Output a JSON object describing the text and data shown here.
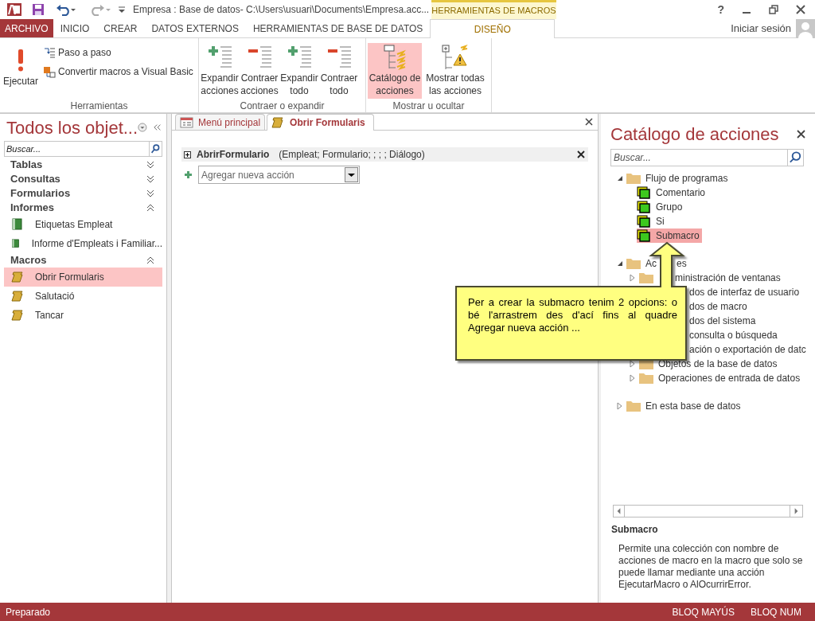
{
  "title_bar": {
    "title": "Empresa : Base de datos- C:\\Users\\usuari\\Documents\\Empresa.acc...",
    "contextual_tab": "HERRAMIENTAS DE MACROS",
    "help": "?"
  },
  "ribbon_tabs": [
    {
      "label": "ARCHIVO",
      "kind": "file",
      "selected": false
    },
    {
      "label": "INICIO",
      "kind": "tab",
      "selected": false
    },
    {
      "label": "CREAR",
      "kind": "tab",
      "selected": false
    },
    {
      "label": "DATOS EXTERNOS",
      "kind": "tab",
      "selected": false
    },
    {
      "label": "HERRAMIENTAS DE BASE DE DATOS",
      "kind": "tab",
      "selected": false
    },
    {
      "label": "DISEÑO",
      "kind": "contextual",
      "selected": true
    }
  ],
  "account": {
    "label": "Iniciar sesión"
  },
  "ribbon_groups": [
    {
      "label": "Herramientas",
      "buttons": [
        {
          "label": "Ejecutar",
          "kind": "run"
        },
        {
          "label": "Paso a paso",
          "kind": "step"
        },
        {
          "label": "Convertir macros a Visual Basic",
          "kind": "convert"
        }
      ]
    },
    {
      "label": "Contraer o expandir",
      "buttons": [
        {
          "label": "Expandir acciones",
          "kind": "expand"
        },
        {
          "label": "Contraer acciones",
          "kind": "collapse"
        },
        {
          "label": "Expandir todo",
          "kind": "expand"
        },
        {
          "label": "Contraer todo",
          "kind": "collapse"
        }
      ]
    },
    {
      "label": "Mostrar u ocultar",
      "buttons": [
        {
          "label": "Catálogo de acciones",
          "kind": "catalog",
          "selected": true
        },
        {
          "label": "Mostrar todas las acciones",
          "kind": "show-all",
          "selected": false
        }
      ]
    }
  ],
  "navigation": {
    "title": "Todos los objet...",
    "search": {
      "placeholder": "Buscar..."
    },
    "groups": [
      {
        "label": "Tablas",
        "expanded": false
      },
      {
        "label": "Consultas",
        "expanded": false
      },
      {
        "label": "Formularios",
        "expanded": false
      },
      {
        "label": "Informes",
        "expanded": true,
        "items": [
          {
            "label": "Etiquetas Empleat",
            "kind": "report",
            "selected": false
          },
          {
            "label": "Informe d'Empleats i Familiar...",
            "kind": "report",
            "selected": false
          }
        ]
      },
      {
        "label": "Macros",
        "expanded": true,
        "items": [
          {
            "label": "Obrir Formularis",
            "kind": "macro",
            "selected": true
          },
          {
            "label": "Salutació",
            "kind": "macro",
            "selected": false
          },
          {
            "label": "Tancar",
            "kind": "macro",
            "selected": false
          }
        ]
      }
    ]
  },
  "document": {
    "tabs": [
      {
        "label": "Menú principal",
        "kind": "form",
        "selected": false
      },
      {
        "label": "Obrir Formularis",
        "kind": "macro",
        "selected": true
      }
    ],
    "actions": [
      {
        "name": "AbrirFormulario",
        "arguments": "(Empleat; Formulario; ; ; ; Diálogo)",
        "expanded": false
      }
    ],
    "new_action": {
      "placeholder": "Agregar nueva acción"
    }
  },
  "catalog": {
    "title": "Catálogo de acciones",
    "search": {
      "placeholder": "Buscar..."
    },
    "tree": [
      {
        "label": "Flujo de programas",
        "kind": "folder",
        "expanded": true,
        "children": [
          {
            "label": "Comentario",
            "kind": "action",
            "selected": false
          },
          {
            "label": "Grupo",
            "kind": "action",
            "selected": false
          },
          {
            "label": "Si",
            "kind": "action",
            "selected": false
          },
          {
            "label": "Submacro",
            "kind": "action",
            "selected": true
          }
        ]
      },
      {
        "label": "Ac",
        "label_end": "es",
        "kind": "folder",
        "expanded": true,
        "children": [
          {
            "label": "ministración de ventanas",
            "kind": "partly-covered-folder",
            "expanded": false
          },
          {
            "label": "dos de interfaz de usuario",
            "kind": "covered-folder"
          },
          {
            "label": "dos de macro",
            "kind": "covered-folder"
          },
          {
            "label": "dos del sistema",
            "kind": "covered-folder"
          },
          {
            "label": "consulta o búsqueda",
            "kind": "covered-folder"
          },
          {
            "label": "ación o exportación de datc",
            "kind": "covered-folder"
          },
          {
            "label": "Objetos de la base de datos",
            "kind": "folder",
            "expanded": false
          },
          {
            "label": "Operaciones de entrada de datos",
            "kind": "folder",
            "expanded": false
          }
        ]
      },
      {
        "label": "En esta base de datos",
        "kind": "folder",
        "expanded": false
      }
    ],
    "description_title": "Submacro",
    "description": "Permite una colección con nombre de acciones de macro en la macro que solo se puede llamar mediante una acción EjecutarMacro o AlOcurrirError."
  },
  "callout": {
    "text": "Per a crear la submacro tenim 2 opcions: o bé l'arrastrem des d'ací fins al quadre Agregar nueva acción ..."
  },
  "status_bar": {
    "text": "Preparado",
    "indicators": [
      "BLOQ MAYÚS",
      "BLOQ NUM"
    ]
  }
}
